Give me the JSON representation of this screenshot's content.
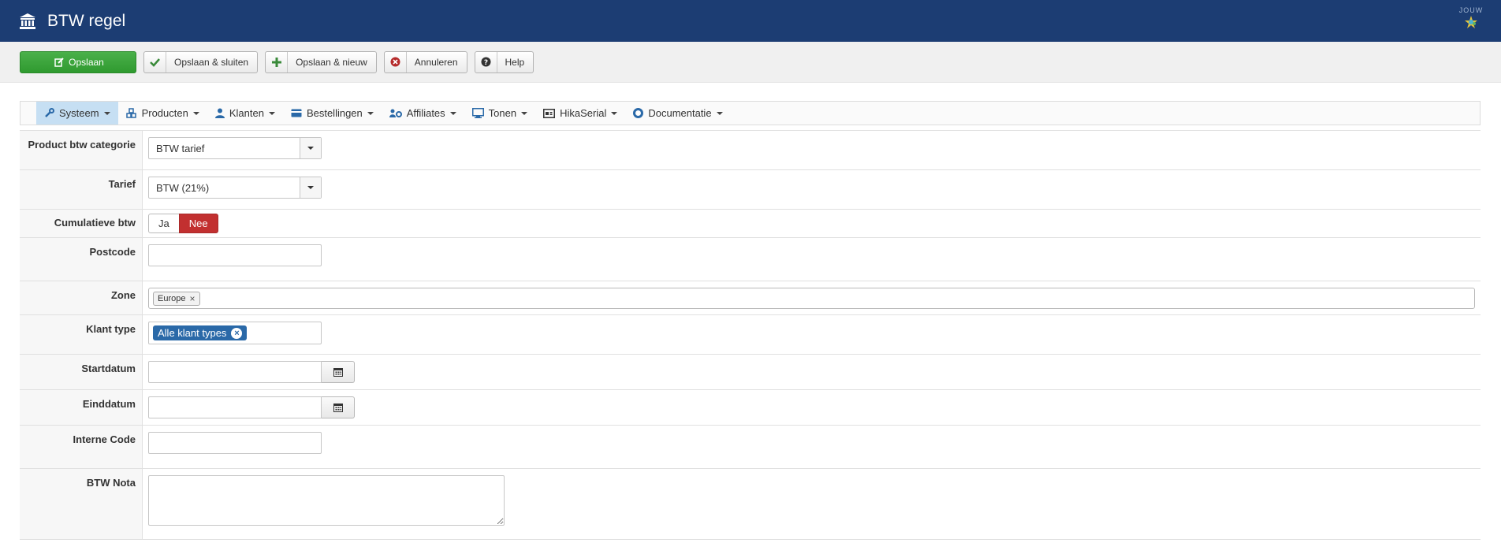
{
  "header": {
    "title": "BTW regel",
    "logo_text": "JOUW"
  },
  "toolbar": {
    "save": "Opslaan",
    "save_close": "Opslaan & sluiten",
    "save_new": "Opslaan & nieuw",
    "cancel": "Annuleren",
    "help": "Help"
  },
  "menu": {
    "items": [
      {
        "label": "Systeem",
        "icon": "wrench-icon"
      },
      {
        "label": "Producten",
        "icon": "cubes-icon"
      },
      {
        "label": "Klanten",
        "icon": "user-icon"
      },
      {
        "label": "Bestellingen",
        "icon": "credit-card-icon"
      },
      {
        "label": "Affiliates",
        "icon": "users-cog-icon"
      },
      {
        "label": "Tonen",
        "icon": "monitor-icon"
      },
      {
        "label": "HikaSerial",
        "icon": "serial-icon"
      },
      {
        "label": "Documentatie",
        "icon": "lifebuoy-icon"
      }
    ],
    "active": "Systeem"
  },
  "form": {
    "category": {
      "label": "Product btw categorie",
      "value": "BTW tarief"
    },
    "tariff": {
      "label": "Tarief",
      "value": "BTW (21%)"
    },
    "cumulative": {
      "label": "Cumulatieve btw",
      "yes": "Ja",
      "no": "Nee",
      "selected": "Nee"
    },
    "postcode": {
      "label": "Postcode",
      "value": ""
    },
    "zone": {
      "label": "Zone",
      "tags": [
        "Europe"
      ]
    },
    "customer_type": {
      "label": "Klant type",
      "tags": [
        "Alle klant types"
      ]
    },
    "start_date": {
      "label": "Startdatum",
      "value": ""
    },
    "end_date": {
      "label": "Einddatum",
      "value": ""
    },
    "internal_code": {
      "label": "Interne Code",
      "value": ""
    },
    "vat_note": {
      "label": "BTW Nota",
      "value": ""
    }
  },
  "colors": {
    "header_bg": "#1c3d73",
    "primary_green": "#3aa53a",
    "toggle_no_red": "#c23030",
    "tag_blue": "#2a69a8",
    "menu_active_bg": "#c6dff3",
    "accent_blue": "#2a69a8"
  }
}
